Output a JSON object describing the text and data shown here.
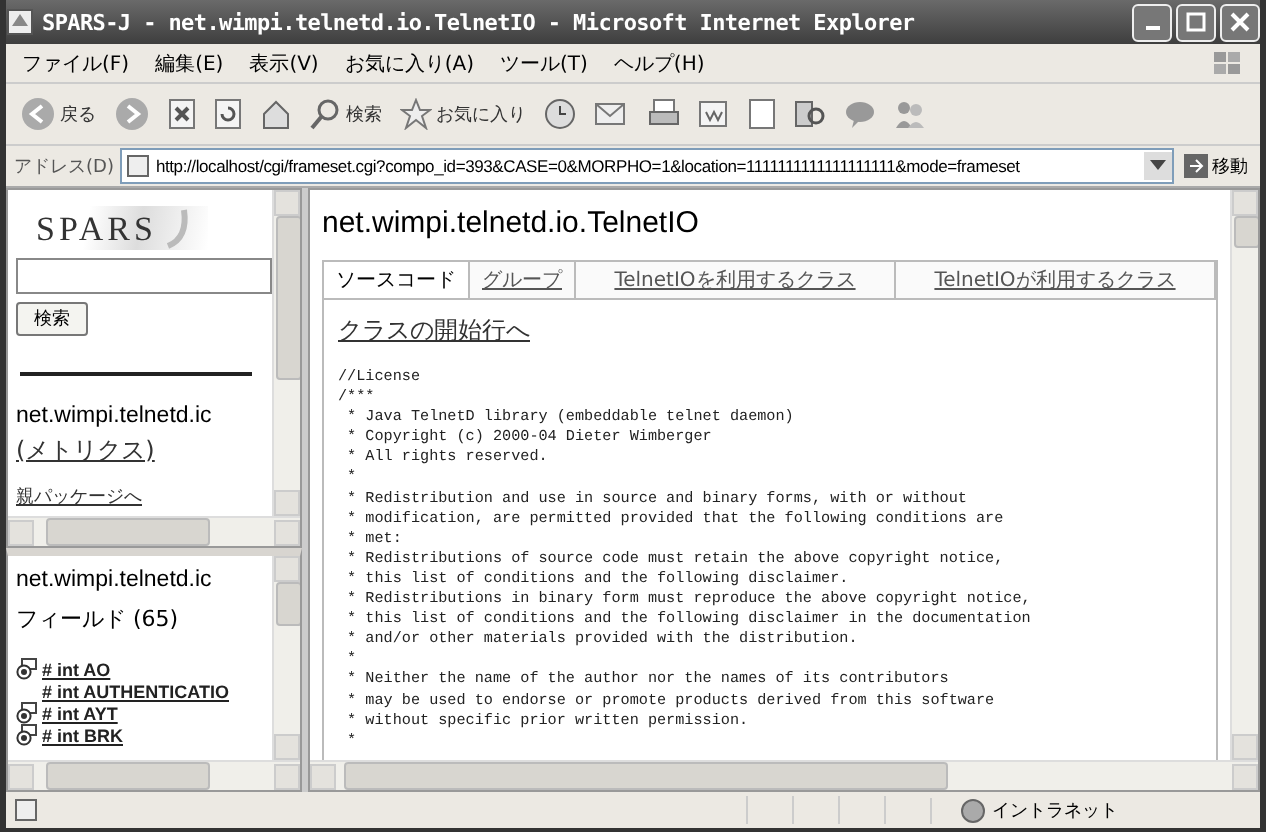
{
  "window": {
    "title": "SPARS-J - net.wimpi.telnetd.io.TelnetIO - Microsoft Internet Explorer"
  },
  "menu": [
    "ファイル(F)",
    "編集(E)",
    "表示(V)",
    "お気に入り(A)",
    "ツール(T)",
    "ヘルプ(H)"
  ],
  "toolbar": {
    "back": "戻る",
    "search": "検索",
    "favorites": "お気に入り"
  },
  "address": {
    "label": "アドレス(D)",
    "value": "http://localhost/cgi/frameset.cgi?compo_id=393&CASE=0&MORPHO=1&location=1111111111111111111&mode=frameset",
    "go": "移動"
  },
  "left_top": {
    "logo_text": "SPARS",
    "search_button": "検索",
    "package": "net.wimpi.telnetd.ic",
    "metrics_link": "(メトリクス)",
    "parent_link": "親パッケージへ"
  },
  "left_bottom": {
    "class_name": "net.wimpi.telnetd.ic",
    "fields_heading": "フィールド (65)",
    "fields": [
      {
        "label": "# int AO",
        "kind": "icon"
      },
      {
        "label": "# int AUTHENTICATIO",
        "kind": "plain"
      },
      {
        "label": "# int AYT",
        "kind": "icon"
      },
      {
        "label": "# int BRK",
        "kind": "icon"
      }
    ]
  },
  "main": {
    "title": "net.wimpi.telnetd.io.TelnetIO",
    "tabs": [
      {
        "label": "ソースコード",
        "selected": true
      },
      {
        "label": "グループ",
        "selected": false
      },
      {
        "label": "TelnetIOを利用するクラス",
        "selected": false
      },
      {
        "label": "TelnetIOが利用するクラス",
        "selected": false
      }
    ],
    "class_start_link": "クラスの開始行へ",
    "code_lines": [
      "//License",
      "/***",
      " * Java TelnetD library (embeddable telnet daemon)",
      " * Copyright (c) 2000-04 Dieter Wimberger",
      " * All rights reserved.",
      " *",
      " * Redistribution and use in source and binary forms, with or without",
      " * modification, are permitted provided that the following conditions are",
      " * met:",
      " * Redistributions of source code must retain the above copyright notice,",
      " * this list of conditions and the following disclaimer.",
      " * Redistributions in binary form must reproduce the above copyright notice,",
      " * this list of conditions and the following disclaimer in the documentation",
      " * and/or other materials provided with the distribution.",
      " *",
      " * Neither the name of the author nor the names of its contributors",
      " * may be used to endorse or promote products derived from this software",
      " * without specific prior written permission.",
      " *"
    ]
  },
  "status_bar": {
    "zone": "イントラネット"
  }
}
